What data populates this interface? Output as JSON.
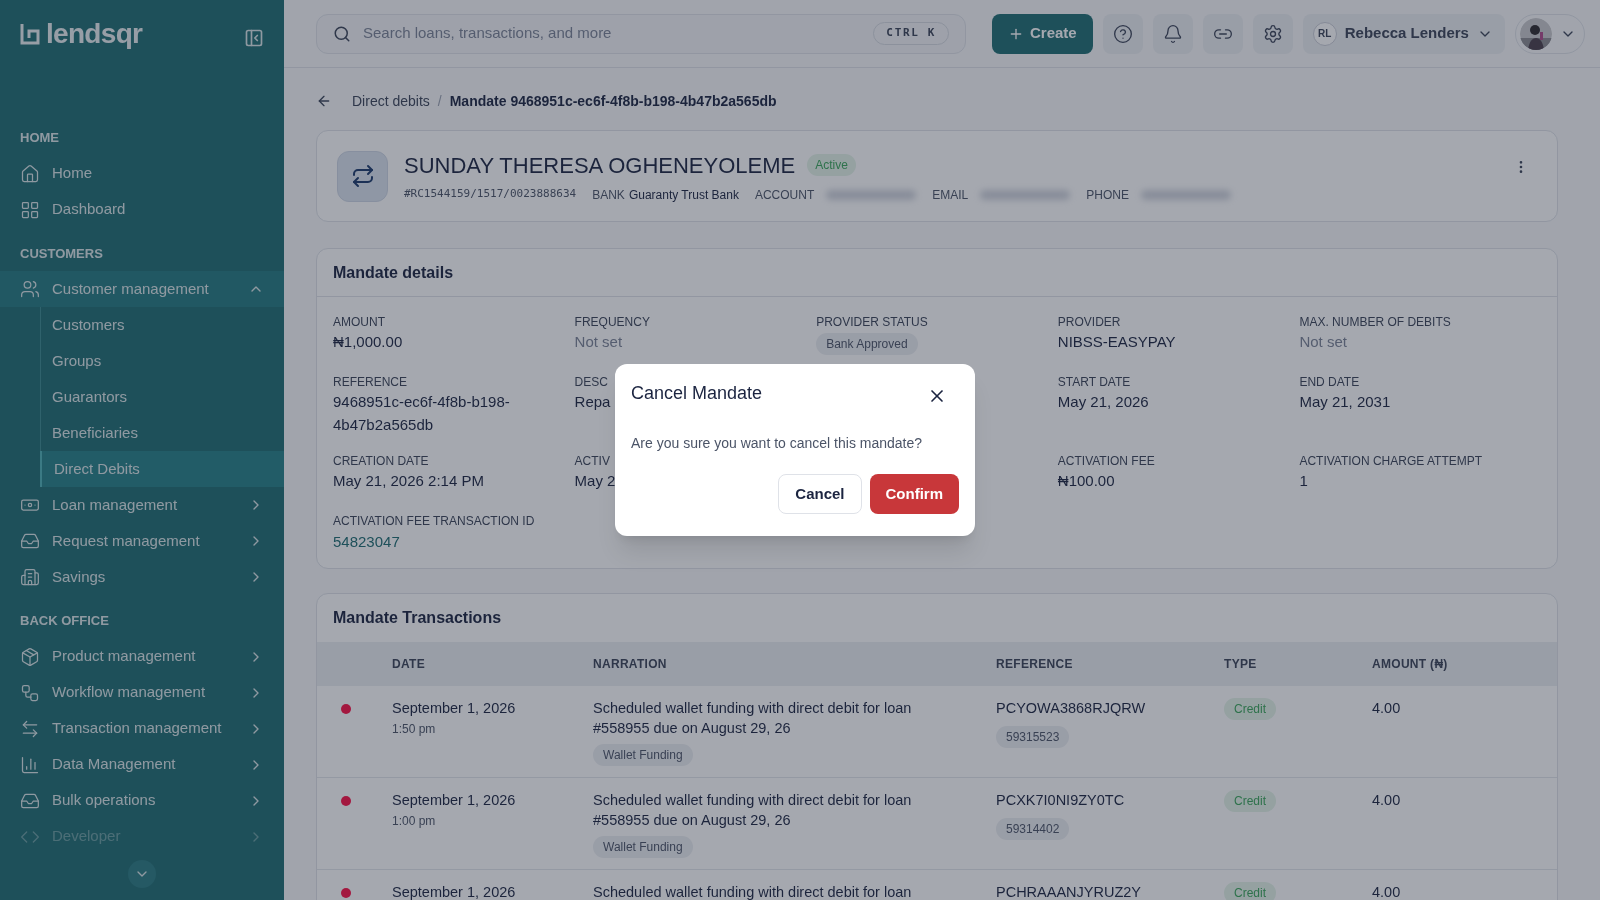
{
  "sidebar": {
    "logo": "lendsqr",
    "sections": [
      {
        "title": "HOME",
        "items": [
          {
            "label": "Home",
            "disabled": false
          },
          {
            "label": "Dashboard",
            "disabled": false
          }
        ]
      },
      {
        "title": "CUSTOMERS",
        "items": [
          {
            "label": "Customer management",
            "disabled": false,
            "expanded": true,
            "children": [
              {
                "label": "Customers",
                "selected": false
              },
              {
                "label": "Groups",
                "selected": false
              },
              {
                "label": "Guarantors",
                "selected": false
              },
              {
                "label": "Beneficiaries",
                "selected": false
              },
              {
                "label": "Direct Debits",
                "selected": true
              }
            ]
          },
          {
            "label": "Loan management",
            "disabled": false,
            "expanded": false
          },
          {
            "label": "Request management",
            "disabled": false,
            "expanded": false
          },
          {
            "label": "Savings",
            "disabled": false,
            "expanded": false
          }
        ]
      },
      {
        "title": "BACK OFFICE",
        "items": [
          {
            "label": "Product management",
            "disabled": false,
            "expanded": false
          },
          {
            "label": "Workflow management",
            "disabled": false,
            "expanded": false
          },
          {
            "label": "Transaction management",
            "disabled": false,
            "expanded": false
          },
          {
            "label": "Data Management",
            "disabled": false,
            "expanded": false
          },
          {
            "label": "Bulk operations",
            "disabled": false,
            "expanded": false
          },
          {
            "label": "Developer",
            "disabled": true,
            "expanded": false
          }
        ]
      }
    ]
  },
  "topbar": {
    "search": {
      "placeholder": "Search loans, transactions, and more",
      "shortcut": "CTRL K"
    },
    "create": "Create",
    "user": {
      "initials": "RL",
      "name": "Rebecca Lenders"
    }
  },
  "breadcrumb": {
    "separator": "/",
    "items": [
      "Direct debits",
      "Mandate 9468951c-ec6f-4f8b-b198-4b47b2a565db"
    ]
  },
  "mandate": {
    "name": "SUNDAY THERESA OGHENEYOLEME",
    "status": "Active",
    "reference": "#RC1544159/1517/0023888634",
    "fields": [
      {
        "label": "BANK",
        "value": "Guaranty Trust Bank",
        "redacted": false
      },
      {
        "label": "ACCOUNT",
        "redacted": true
      },
      {
        "label": "EMAIL",
        "redacted": true
      },
      {
        "label": "PHONE",
        "redacted": true
      }
    ]
  },
  "details": {
    "title": "Mandate details",
    "rows": [
      [
        {
          "label": "AMOUNT",
          "value": "₦1,000.00",
          "kind": "text"
        },
        {
          "label": "FREQUENCY",
          "value": "Not set",
          "kind": "muted"
        },
        {
          "label": "PROVIDER STATUS",
          "value": "Bank Approved",
          "kind": "badge"
        },
        {
          "label": "PROVIDER",
          "value": "NIBSS-EASYPAY",
          "kind": "text"
        },
        {
          "label": "MAX. NUMBER OF DEBITS",
          "value": "Not set",
          "kind": "muted"
        }
      ],
      [
        {
          "label": "REFERENCE",
          "value": "9468951c-ec6f-4f8b-b198-4b47b2a565db",
          "kind": "text"
        },
        {
          "label": "DESC",
          "value": "Repa",
          "kind": "text"
        },
        null,
        {
          "label": "START DATE",
          "value": "May 21, 2026",
          "kind": "text"
        },
        {
          "label": "END DATE",
          "value": "May 21, 2031",
          "kind": "text"
        }
      ],
      [
        {
          "label": "CREATION DATE",
          "value": "May 21, 2026 2:14 PM",
          "kind": "text"
        },
        {
          "label": "ACTIV",
          "value": "May 2",
          "kind": "text"
        },
        null,
        {
          "label": "ACTIVATION FEE",
          "value": "₦100.00",
          "kind": "text"
        },
        {
          "label": "ACTIVATION CHARGE ATTEMPT",
          "value": "1",
          "kind": "text"
        }
      ],
      [
        {
          "label": "ACTIVATION FEE TRANSACTION ID",
          "value": "54823047",
          "kind": "link"
        }
      ]
    ]
  },
  "transactions": {
    "title": "Mandate Transactions",
    "columns": [
      "DATE",
      "NARRATION",
      "REFERENCE",
      "TYPE",
      "AMOUNT (₦)"
    ],
    "rows": [
      {
        "color": "#a3183f",
        "date": "September 1, 2026",
        "time": "1:50 pm",
        "narration": "Scheduled wallet funding with direct debit for loan #558955 due on August 29, 26",
        "tag": "Wallet Funding",
        "reference": "PCYOWA3868RJQRW",
        "ref_id": "59315523",
        "type": "Credit",
        "amount": "4.00"
      },
      {
        "color": "#a3183f",
        "date": "September 1, 2026",
        "time": "1:00 pm",
        "narration": "Scheduled wallet funding with direct debit for loan #558955 due on August 29, 26",
        "tag": "Wallet Funding",
        "reference": "PCXK7I0NI9ZY0TC",
        "ref_id": "59314402",
        "type": "Credit",
        "amount": "4.00"
      },
      {
        "color": "#a3183f",
        "date": "September 1, 2026",
        "narration": "Scheduled wallet funding with direct debit for loan",
        "reference": "PCHRAAANJYRUZ2Y",
        "type": "Credit",
        "amount": "4.00"
      }
    ]
  },
  "modal": {
    "title": "Cancel Mandate",
    "message": "Are you sure you want to cancel this mandate?",
    "cancel": "Cancel",
    "confirm": "Confirm"
  }
}
